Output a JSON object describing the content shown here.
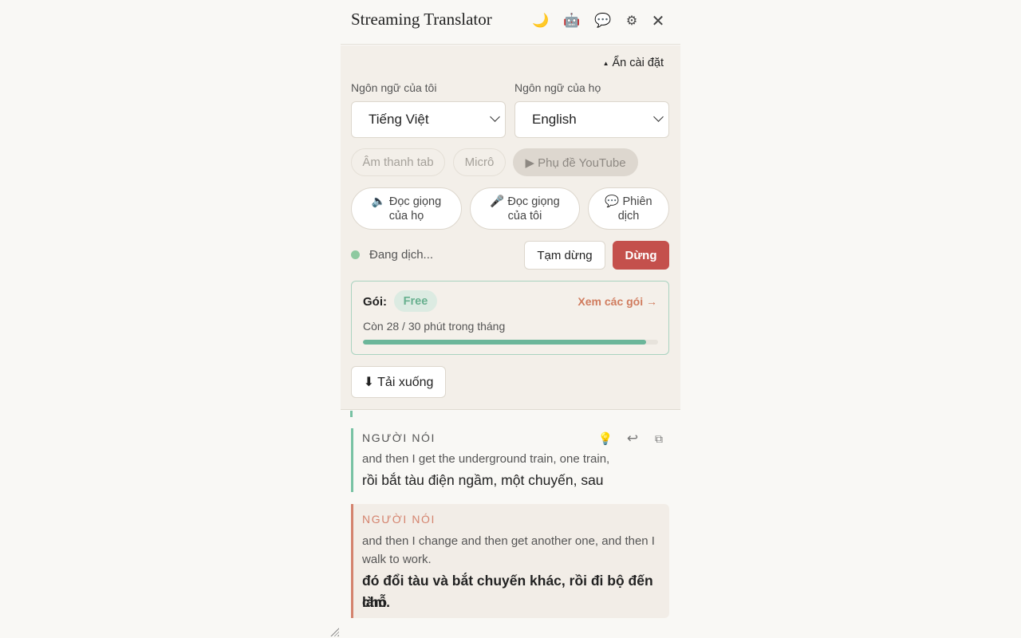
{
  "header": {
    "title": "Streaming Translator",
    "icons": {
      "moon": "🌙",
      "robot": "🤖",
      "chat": "💬",
      "gear": "⚙",
      "close": "✕"
    }
  },
  "settings": {
    "hide_label": "Ẩn cài đặt",
    "hide_arrow": "▲",
    "my_language_label": "Ngôn ngữ của tôi",
    "my_language_value": "Tiếng Việt",
    "their_language_label": "Ngôn ngữ của họ",
    "their_language_value": "English",
    "sources": {
      "tab_audio": "Âm thanh tab",
      "mic": "Micrô",
      "youtube": "▶ Phụ đề YouTube"
    },
    "voice_buttons": {
      "read_theirs": [
        "🔈 Đọc giọng",
        "của họ"
      ],
      "read_mine": [
        "🎤 Đọc giọng",
        "của tôi"
      ],
      "interpret": [
        "💬 Phiên",
        "dịch"
      ]
    },
    "status": {
      "text": "Đang dịch...",
      "dot_color": "#8ec9a0",
      "pause_label": "Tạm dừng",
      "stop_label": "Dừng",
      "stop_color": "#c4504c"
    },
    "plan": {
      "label": "Gói:",
      "tier": "Free",
      "link": "Xem các gói →",
      "remaining": "Còn 28 / 30 phút trong tháng",
      "used_fraction": 0.96
    },
    "download_label": "⬇ Tải xuống"
  },
  "transcript": {
    "cut_text": "...y ... ... ... ... ... ... ... ... ...",
    "entries": [
      {
        "speaker": "NGƯỜI NÓI",
        "original": "and then I get the underground train, one train,",
        "translation": "rồi bắt tàu điện ngầm, một chuyến, sau",
        "icons": {
          "bulb": "💡",
          "reply": "↩",
          "copy": "⧉"
        }
      },
      {
        "speaker": "NGƯỜI NÓI",
        "original_line1": "and then I change and then get another one, and then I",
        "original_line2": "walk to work.",
        "translation_line1": "đó đổi tàu và bắt chuyến khác, rồi đi bộ đến chỗ",
        "translation_line2": "làm."
      }
    ]
  }
}
